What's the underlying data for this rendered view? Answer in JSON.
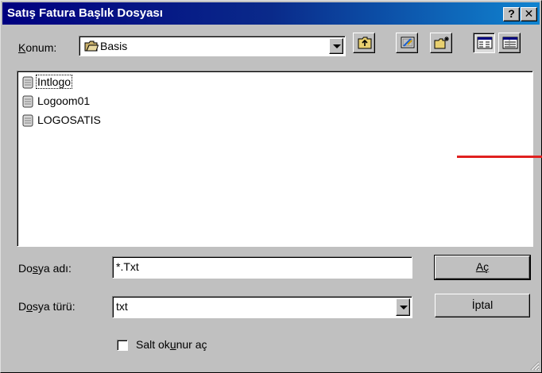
{
  "window": {
    "title": "Satış Fatura Başlık Dosyası"
  },
  "titlebar_buttons": {
    "help": "?",
    "close": "✕"
  },
  "location": {
    "label": "Konum:",
    "value": "Basis",
    "icon": "folder-icon"
  },
  "toolbar": [
    {
      "name": "up-one-level-button",
      "icon": "folder-up-icon"
    },
    {
      "name": "desktop-button",
      "icon": "desktop-icon"
    },
    {
      "name": "new-folder-button",
      "icon": "new-folder-icon"
    },
    {
      "name": "list-view-button",
      "icon": "list-view-icon"
    },
    {
      "name": "details-view-button",
      "icon": "details-view-icon"
    }
  ],
  "files": [
    {
      "name": "Intlogo",
      "icon": "document-icon",
      "focused": true
    },
    {
      "name": "Logoom01",
      "icon": "document-icon",
      "focused": false
    },
    {
      "name": "LOGOSATIS",
      "icon": "document-icon",
      "focused": false
    }
  ],
  "filename": {
    "label": "Dosya adı:",
    "value": "*.Txt"
  },
  "filetype": {
    "label": "Dosya türü:",
    "value": "txt"
  },
  "readonly": {
    "label": "Salt okunur aç",
    "checked": false
  },
  "buttons": {
    "open": "Aç",
    "cancel": "İptal"
  },
  "colors": {
    "title_start": "#000080",
    "title_end": "#1084d0",
    "face": "#c0c0c0",
    "annotation": "#e0201f"
  }
}
